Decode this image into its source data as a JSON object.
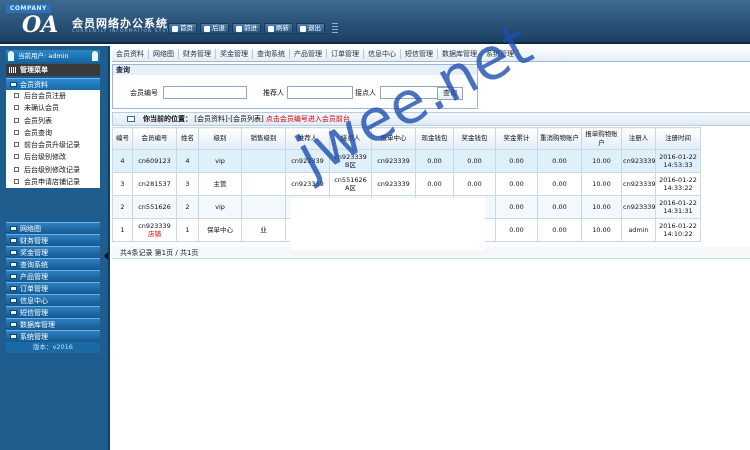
{
  "header": {
    "company": "COMPANY",
    "logo_text": "OA",
    "title": "会员网络办公系统",
    "subtitle": "CURRENTLY INFORMATION SYSTEM",
    "buttons": [
      "首页",
      "后退",
      "前进",
      "刷新",
      "退出"
    ]
  },
  "sidebar": {
    "user_label": "当前用户: admin",
    "menu_title": "管理菜单",
    "groups_top": [
      {
        "label": "会员资料",
        "items": [
          "后台会员注册",
          "未确认会员",
          "会员列表",
          "会员查询",
          "前台会员升级记录",
          "后台级别修改",
          "后台级别修改记录",
          "会员申请店铺记录"
        ]
      }
    ],
    "groups_bottom": [
      "网络图",
      "财务管理",
      "奖金管理",
      "查询系统",
      "产品管理",
      "订单管理",
      "信息中心",
      "短信管理",
      "数据库管理",
      "系统管理"
    ],
    "version": "版本：v2016"
  },
  "tabs": [
    "会员资料",
    "网络图",
    "财务管理",
    "奖金管理",
    "查询系统",
    "产品管理",
    "订单管理",
    "信息中心",
    "短信管理",
    "数据库管理",
    "系统管理"
  ],
  "search": {
    "title": "查询",
    "member_id_label": "会员编号",
    "referrer_label": "推荐人",
    "contact_label": "接点人",
    "member_id_value": "",
    "referrer_value": "",
    "contact_value": "",
    "button": "查询"
  },
  "breadcrumb": {
    "label": "你当前的位置：",
    "path": "[会员资料]-[会员列表]",
    "hint": "点击会员编号进入会员前台"
  },
  "table": {
    "headers": [
      "编号",
      "会员编号",
      "姓名",
      "级别",
      "销售级别",
      "推荐人",
      "接点人",
      "报单中心",
      "现金钱包",
      "奖金钱包",
      "奖金累计",
      "重消购物账户",
      "报单购物账户",
      "注册人",
      "注册时间"
    ],
    "rows": [
      {
        "no": "4",
        "id": "cn609123",
        "name": "4",
        "level": "vip",
        "sales": "",
        "ref": "cn923339",
        "contact": "cn923339 B区",
        "center": "cn923339",
        "cash": "0.00",
        "bonus": "0.00",
        "bonus_total": "0.00",
        "resale": "0.00",
        "order_acct": "10.00",
        "registrar": "cn923339",
        "time": "2016-01-22 14:53:33",
        "status": ""
      },
      {
        "no": "3",
        "id": "cn281537",
        "name": "3",
        "level": "主管",
        "sales": "",
        "ref": "cn923339",
        "contact": "cn551626 A区",
        "center": "cn923339",
        "cash": "0.00",
        "bonus": "0.00",
        "bonus_total": "0.00",
        "resale": "0.00",
        "order_acct": "10.00",
        "registrar": "cn923339",
        "time": "2016-01-22 14:33:22",
        "status": ""
      },
      {
        "no": "2",
        "id": "cn551626",
        "name": "2",
        "level": "vip",
        "sales": "",
        "ref": "",
        "contact": "",
        "center": "",
        "cash": "",
        "bonus": "",
        "bonus_total": "0.00",
        "resale": "0.00",
        "order_acct": "10.00",
        "registrar": "cn923339",
        "time": "2016-01-22 14:31:31",
        "status": ""
      },
      {
        "no": "1",
        "id": "cn923339",
        "name": "1",
        "level": "保单中心",
        "sales": "业",
        "ref": "",
        "contact": "",
        "center": "",
        "cash": "",
        "bonus": "",
        "bonus_total": "0.00",
        "resale": "0.00",
        "order_acct": "10.00",
        "registrar": "admin",
        "time": "2016-01-22 14:10:22",
        "status": "店铺"
      }
    ]
  },
  "pager": "共4条记录  第1页 / 共1页",
  "watermark": "jwee.net"
}
